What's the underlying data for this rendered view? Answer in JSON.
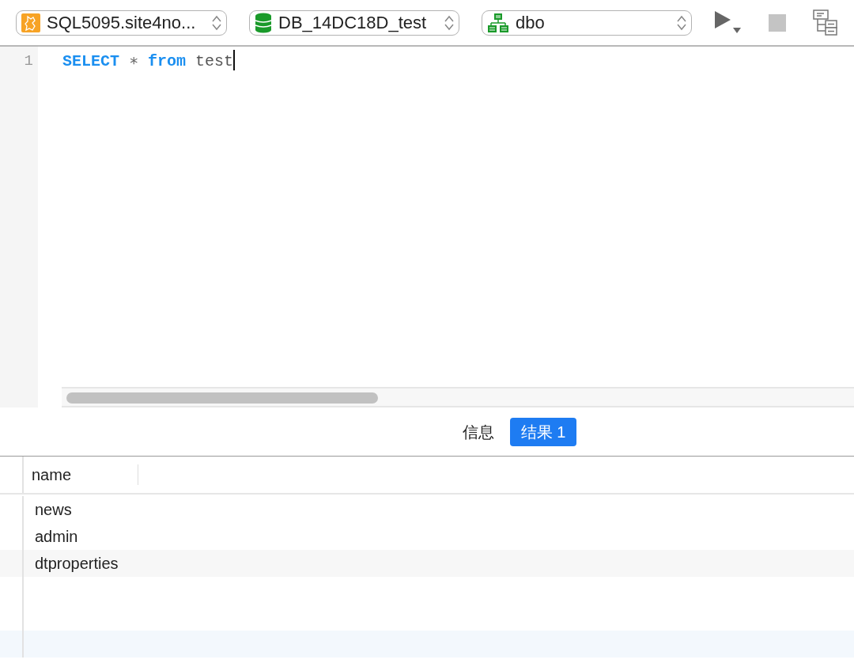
{
  "toolbar": {
    "selectors": [
      {
        "kind": "server",
        "value": "SQL5095.site4no..."
      },
      {
        "kind": "database",
        "value": "DB_14DC18D_test"
      },
      {
        "kind": "schema",
        "value": "dbo"
      }
    ],
    "buttons": [
      {
        "kind": "run",
        "disabled": false
      },
      {
        "kind": "stop",
        "disabled": true
      },
      {
        "kind": "plan",
        "disabled": false
      }
    ]
  },
  "editor": {
    "lines": [
      {
        "number": "1",
        "cursor": true,
        "tokens": [
          {
            "text": "SELECT",
            "kind": "keyword"
          },
          {
            "text": "∗",
            "kind": "operator"
          },
          {
            "text": "from",
            "kind": "keyword"
          },
          {
            "text": "test",
            "kind": "identifier"
          }
        ]
      }
    ]
  },
  "result_tabs": [
    {
      "label": "信息",
      "selected": false
    },
    {
      "label": "结果 1",
      "selected": true
    }
  ],
  "table": {
    "columns": [
      "name"
    ],
    "rows": [
      [
        "news"
      ],
      [
        "admin"
      ],
      [
        "dtproperties"
      ]
    ]
  }
}
